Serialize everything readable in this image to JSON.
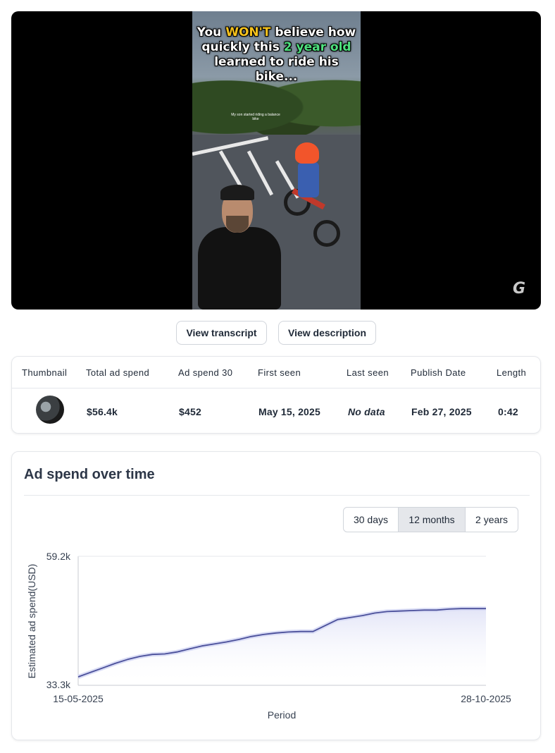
{
  "video": {
    "caption_part1": "You ",
    "caption_highlight1": "WON'T",
    "caption_part2": " believe how quickly this ",
    "caption_highlight2": "2 year old",
    "caption_part3": " learned to ride his bike...",
    "subcaption": "My son started riding a balance bike",
    "logo_text": "G"
  },
  "actions": {
    "transcript_label": "View transcript",
    "description_label": "View description"
  },
  "stats_table": {
    "headers": [
      "Thumbnail",
      "Total ad spend",
      "Ad spend 30",
      "First seen",
      "Last seen",
      "Publish Date",
      "Length"
    ],
    "row": {
      "total_ad_spend": "$56.4k",
      "ad_spend_30": "$452",
      "first_seen": "May 15, 2025",
      "last_seen": "No data",
      "publish_date": "Feb 27, 2025",
      "length": "0:42"
    }
  },
  "chart_section": {
    "title": "Ad spend over time",
    "ranges": [
      "30 days",
      "12 months",
      "2 years"
    ],
    "active_range": "12 months"
  },
  "chart_data": {
    "type": "area",
    "ylabel": "Estimated ad spend(USD)",
    "xlabel": "Period",
    "x_start_label": "15-05-2025",
    "x_end_label": "28-10-2025",
    "ylim_labels": [
      "33.3k",
      "59.2k"
    ],
    "ylim": [
      33300,
      59200
    ],
    "x": [
      "15-05-2025",
      "20-05-2025",
      "25-05-2025",
      "30-05-2025",
      "04-06-2025",
      "09-06-2025",
      "14-06-2025",
      "19-06-2025",
      "24-06-2025",
      "29-06-2025",
      "04-07-2025",
      "09-07-2025",
      "14-07-2025",
      "19-07-2025",
      "24-07-2025",
      "29-07-2025",
      "03-08-2025",
      "08-08-2025",
      "13-08-2025",
      "18-08-2025",
      "23-08-2025",
      "28-08-2025",
      "02-09-2025",
      "07-09-2025",
      "12-09-2025",
      "17-09-2025",
      "22-09-2025",
      "27-09-2025",
      "02-10-2025",
      "07-10-2025",
      "12-10-2025",
      "17-10-2025",
      "22-10-2025",
      "28-10-2025"
    ],
    "values": [
      35000,
      35900,
      36800,
      37700,
      38500,
      39100,
      39500,
      39600,
      40000,
      40600,
      41200,
      41600,
      42000,
      42500,
      43100,
      43500,
      43800,
      44000,
      44100,
      44100,
      45300,
      46500,
      46900,
      47300,
      47800,
      48100,
      48200,
      48300,
      48400,
      48400,
      48600,
      48700,
      48700,
      48700
    ],
    "line_color": "#4a4f9a",
    "fill_color": "#d9dcf5"
  }
}
